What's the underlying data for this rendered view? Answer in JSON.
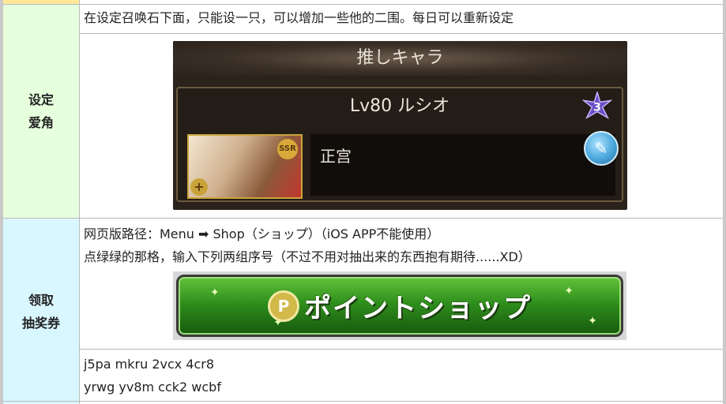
{
  "rows": {
    "row1": {
      "label_lines": [
        "设定",
        "爱角"
      ]
    },
    "row2": {
      "label_lines": [
        "领取",
        "抽奖券"
      ]
    }
  },
  "desc1": "在设定召唤石下面，只能设一只，可以增加一些他的二围。每日可以重新设定",
  "oshi": {
    "title": "推しキャラ",
    "name": "Lv80 ルシオ",
    "badge_number": "3",
    "ssr": "SSR",
    "comment": "正宫"
  },
  "desc2": {
    "line1": "网页版路径：Menu ➡ Shop（ショップ）（iOS APP不能使用）",
    "line2": "点绿绿的那格，输入下列两组序号（不过不用对抽出来的东西抱有期待......XD）"
  },
  "shop_banner": {
    "label": "ポイントショップ",
    "icon": "P"
  },
  "codes": [
    "j5pa mkru 2vcx 4cr8",
    "yrwg yv8m cck2 wcbf"
  ],
  "colors": {
    "row1_bg": "#e6ffdd",
    "row2_bg": "#d9f7ff",
    "top_band": "#ffe898"
  }
}
